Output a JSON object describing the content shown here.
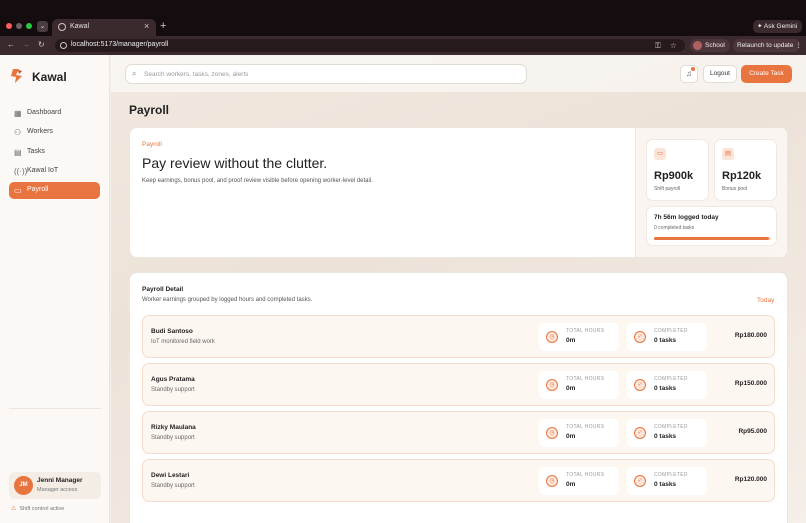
{
  "browser": {
    "tab_title": "Kawal",
    "new_tab": "+",
    "tab_close": "×",
    "ask_gemini": "Ask Gemini",
    "url": "localhost:5173/manager/payroll",
    "profile_name": "School",
    "relaunch": "Relaunch to update"
  },
  "app": {
    "brand": "Kawal"
  },
  "sidebar": {
    "items": [
      {
        "label": "Dashboard",
        "icon": "grid-icon"
      },
      {
        "label": "Workers",
        "icon": "users-icon"
      },
      {
        "label": "Tasks",
        "icon": "clipboard-icon"
      },
      {
        "label": "Kawal IoT",
        "icon": "signal-icon"
      },
      {
        "label": "Payroll",
        "icon": "wallet-icon",
        "active": true
      }
    ],
    "user": {
      "initials": "JM",
      "name": "Jenni Manager",
      "role": "Manager access"
    },
    "shift_status": "Shift control active"
  },
  "topbar": {
    "search_placeholder": "Search workers, tasks, zones, alerts",
    "logout": "Logout",
    "create_task": "Create Task"
  },
  "page": {
    "title": "Payroll"
  },
  "hero": {
    "eyebrow": "Payroll",
    "title": "Pay review without the clutter.",
    "description": "Keep earnings, bonus pool, and proof review visible before opening worker-level detail.",
    "stats": [
      {
        "value": "Rp900k",
        "label": "Shift payroll"
      },
      {
        "value": "Rp120k",
        "label": "Bonus pool"
      }
    ],
    "logged": {
      "title": "7h 56m logged today",
      "subtitle": "0 completed tasks",
      "progress": 0.98
    }
  },
  "detail": {
    "title": "Payroll Detail",
    "subtitle": "Worker earnings grouped by logged hours and completed tasks.",
    "period": "Today",
    "hours_label": "TOTAL HOURS",
    "completed_label": "COMPLETED",
    "rows": [
      {
        "name": "Budi Santoso",
        "role": "IoT monitored field work",
        "hours": "0m",
        "completed": "0 tasks",
        "amount": "Rp180.000"
      },
      {
        "name": "Agus Pratama",
        "role": "Standby support",
        "hours": "0m",
        "completed": "0 tasks",
        "amount": "Rp150.000"
      },
      {
        "name": "Rizky Maulana",
        "role": "Standby support",
        "hours": "0m",
        "completed": "0 tasks",
        "amount": "Rp95.000"
      },
      {
        "name": "Dewi Lestari",
        "role": "Standby support",
        "hours": "0m",
        "completed": "0 tasks",
        "amount": "Rp120.000"
      }
    ]
  },
  "colors": {
    "accent": "#e8743f",
    "accent_soft": "#fbe5d8"
  }
}
